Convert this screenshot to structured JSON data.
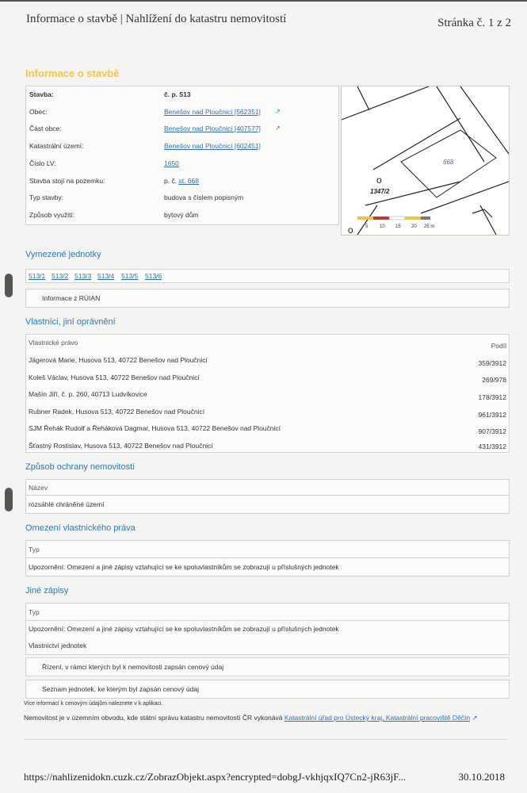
{
  "header": {
    "title": "Informace o stavbě | Nahlížení do katastru nemovitostí",
    "page": "Stránka č. 1 z 2"
  },
  "main_heading": "Informace o stavbě",
  "building": {
    "rows": [
      {
        "label": "Stavba:",
        "value": "č. p. 513",
        "link": false
      },
      {
        "label": "Obec:",
        "value": "Benešov nad Ploučnicí [562351]",
        "link": true
      },
      {
        "label": "Část obce:",
        "value": "Benešov nad Ploučnicí [407577]",
        "link": true
      },
      {
        "label": "Katastrální území:",
        "value": "Benešov nad Ploučnicí [602451]",
        "link": true
      },
      {
        "label": "Číslo LV:",
        "value": "1650",
        "link": true
      },
      {
        "label": "Stavba stojí na pozemku:",
        "value_prefix": "p. č. ",
        "value_link": "st. 668"
      },
      {
        "label": "Typ stavby:",
        "value": "budova s číslem popisným",
        "link": false
      },
      {
        "label": "Způsob využití:",
        "value": "bytový dům",
        "link": false
      }
    ]
  },
  "map": {
    "parcel_label": "668",
    "parcel_number": "1347/2",
    "scale_labels": [
      "5",
      "10",
      "15",
      "20",
      "25 m"
    ]
  },
  "units": {
    "heading": "Vymezené jednotky",
    "items": [
      "513/1",
      "513/2",
      "513/3",
      "513/4",
      "513/5",
      "513/6"
    ],
    "ruian_label": "Informace z RÚIAN"
  },
  "owners": {
    "heading": "Vlastníci, jiní oprávnění",
    "col_left": "Vlastnické právo",
    "col_right": "Podíl",
    "rows": [
      {
        "name": "Jägerová Marie, Husova 513, 40722 Benešov nad Ploučnicí",
        "share": "359/3912"
      },
      {
        "name": "Koleš Václav, Husova 513, 40722 Benešov nad Ploučnicí",
        "share": "269/978"
      },
      {
        "name": "Mašín Jiří, č. p. 260, 40713 Ludvíkovice",
        "share": "178/3912"
      },
      {
        "name": "Rubner Radek, Husova 513, 40722 Benešov nad Ploučnicí",
        "share": "961/3912"
      },
      {
        "name": "SJM Řehák Rudolf a Řeháková Dagmar, Husova 513, 40722 Benešov nad Ploučnicí",
        "share": "907/3912"
      },
      {
        "name": "Šťastný Rostislav, Husova 513, 40722 Benešov nad Ploučnicí",
        "share": "431/3912"
      }
    ]
  },
  "protection": {
    "heading": "Způsob ochrany nemovitosti",
    "col": "Název",
    "value": "rozsáhlé chráněné území"
  },
  "restriction": {
    "heading": "Omezení vlastnického práva",
    "col": "Typ",
    "value": "Upozornění: Omezení a jiné zápisy vztahující se ke spoluvlastníkům se zobrazují u příslušných jednotek"
  },
  "other": {
    "heading": "Jiné zápisy",
    "col": "Typ",
    "value1": "Upozornění: Omezení a jiné zápisy vztahující se ke spoluvlastníkům se zobrazují u příslušných jednotek",
    "value2": "Vlastnictví jednotek"
  },
  "price": {
    "item1": "Řízení, v rámci kterých byl k nemovitosti zapsán cenový údaj",
    "item2": "Seznam jednotek, ke kterým byl zapsán cenový údaj",
    "note": "Více informací k cenovým údajům naleznete v k aplikaci."
  },
  "office": {
    "text": "Nemovitost je v územním obvodu, kde státní správu katastru nemovitostí ČR vykonává ",
    "link": "Katastrální úřad pro Ústecký kraj, Katastrální pracoviště Děčín"
  },
  "footer": {
    "url": "https://nahlizenidokn.cuzk.cz/ZobrazObjekt.aspx?encrypted=dobgJ-vkhjqxIQ7Cn2-jR63jF...",
    "date": "30.10.2018"
  }
}
